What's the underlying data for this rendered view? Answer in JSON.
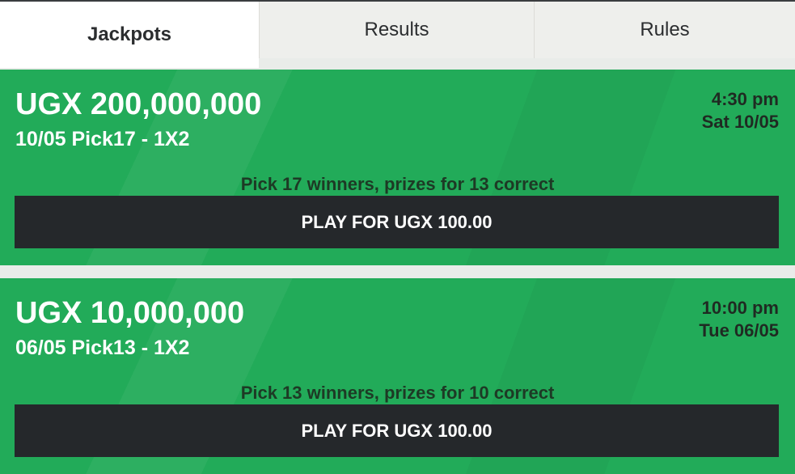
{
  "tabs": [
    {
      "label": "Jackpots",
      "active": true
    },
    {
      "label": "Results",
      "active": false
    },
    {
      "label": "Rules",
      "active": false
    }
  ],
  "jackpots": [
    {
      "amount": "UGX 200,000,000",
      "subtitle": "10/05 Pick17 - 1X2",
      "time": "4:30 pm",
      "date": "Sat 10/05",
      "description": "Pick 17 winners, prizes for 13 correct",
      "play_label": "PLAY FOR UGX 100.00"
    },
    {
      "amount": "UGX 10,000,000",
      "subtitle": "06/05 Pick13 - 1X2",
      "time": "10:00 pm",
      "date": "Tue 06/05",
      "description": "Pick 13 winners, prizes for 10 correct",
      "play_label": "PLAY FOR UGX 100.00"
    }
  ],
  "colors": {
    "card_green": "#22ab59",
    "button_dark": "#25282b",
    "tab_active_bg": "#ffffff",
    "tab_inactive_bg": "#eeefec"
  }
}
